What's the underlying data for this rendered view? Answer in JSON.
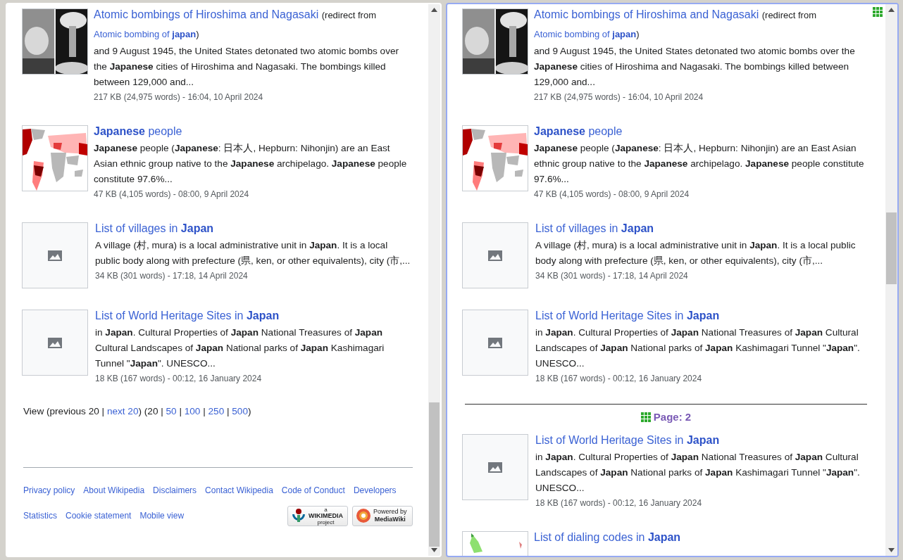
{
  "panes": [
    {
      "focused": false,
      "items": [
        {
          "kind": "result",
          "title": "Atomic bombings of Hiroshima and Nagasaki",
          "redirect_prefix": "(redirect from ",
          "redirect_title": "Atomic bombing of **japan**",
          "redirect_suffix": ")",
          "snippet": "and 9 August 1945, the United States detonated two atomic bombs over the **Japanese** cities of Hiroshima and Nagasaki. The bombings killed between 129,000 and...",
          "meta": "217 KB (24,975 words) - 16:04, 10 April 2024"
        },
        {
          "kind": "result",
          "thumb": {
            "kind": "map"
          },
          "title": "**Japanese** people",
          "snippet": "**Japanese** people (**Japanese**: 日本人, Hepburn: Nihonjin) are an East Asian ethnic group native to the **Japanese** archipelago. **Japanese** people constitute 97.6%...",
          "meta": "47 KB (4,105 words) - 08:00, 9 April 2024"
        },
        {
          "kind": "result",
          "thumb": {
            "kind": "placeholder"
          },
          "title": "List of villages in **Japan**",
          "snippet": "A village (村, mura) is a local administrative unit in **Japan**. It is a local public body along with prefecture (県, ken, or other equivalents), city (市,...",
          "meta": "34 KB (301 words) - 17:18, 14 April 2024"
        },
        {
          "kind": "result",
          "thumb": {
            "kind": "placeholder"
          },
          "title": "List of World Heritage Sites in **Japan**",
          "snippet": "in **Japan**. Cultural Properties of **Japan** National Treasures of **Japan** Cultural Landscapes of **Japan** National parks of **Japan** Kashimagari Tunnel \"**Japan**\". UNESCO...",
          "meta": "18 KB (167 words) - 00:12, 16 January 2024"
        },
        {
          "kind": "pager",
          "parts": [
            {
              "text": "View (previous 20 | ",
              "link": false
            },
            {
              "text": "next 20",
              "link": true
            },
            {
              "text": ") (20 | ",
              "link": false
            },
            {
              "text": "50",
              "link": true
            },
            {
              "text": " | ",
              "link": false
            },
            {
              "text": "100",
              "link": true
            },
            {
              "text": " | ",
              "link": false
            },
            {
              "text": "250",
              "link": true
            },
            {
              "text": " | ",
              "link": false
            },
            {
              "text": "500",
              "link": true
            },
            {
              "text": ")",
              "link": false
            }
          ]
        },
        {
          "kind": "footer",
          "rows": [
            [
              "Privacy policy",
              "About Wikipedia",
              "Disclaimers",
              "Contact Wikipedia",
              "Code of Conduct",
              "Developers"
            ],
            [
              "Statistics",
              "Cookie statement",
              "Mobile view"
            ]
          ],
          "badges": [
            {
              "kind": "wikimedia",
              "lines": [
                "a",
                "WIKIMEDIA",
                "project"
              ]
            },
            {
              "kind": "mediawiki",
              "lines": [
                "Powered by",
                "MediaWiki"
              ]
            }
          ]
        }
      ]
    },
    {
      "focused": true,
      "items": [
        {
          "kind": "result",
          "title": "Atomic bombings of Hiroshima and Nagasaki",
          "redirect_prefix": "(redirect from ",
          "redirect_title": "Atomic bombing of **japan**",
          "redirect_suffix": ")",
          "snippet": "and 9 August 1945, the United States detonated two atomic bombs over the **Japanese** cities of Hiroshima and Nagasaki. The bombings killed between 129,000 and...",
          "meta": "217 KB (24,975 words) - 16:04, 10 April 2024"
        },
        {
          "kind": "result",
          "thumb": {
            "kind": "map"
          },
          "title": "**Japanese** people",
          "snippet": "**Japanese** people (**Japanese**: 日本人, Hepburn: Nihonjin) are an East Asian ethnic group native to the **Japanese** archipelago. **Japanese** people constitute 97.6%...",
          "meta": "47 KB (4,105 words) - 08:00, 9 April 2024"
        },
        {
          "kind": "result",
          "thumb": {
            "kind": "placeholder"
          },
          "title": "List of villages in **Japan**",
          "snippet": "A village (村, mura) is a local administrative unit in **Japan**. It is a local public body along with prefecture (県, ken, or other equivalents), city (市,...",
          "meta": "34 KB (301 words) - 17:18, 14 April 2024"
        },
        {
          "kind": "result",
          "thumb": {
            "kind": "placeholder"
          },
          "title": "List of World Heritage Sites in **Japan**",
          "snippet": "in **Japan**. Cultural Properties of **Japan** National Treasures of **Japan** Cultural Landscapes of **Japan** National parks of **Japan** Kashimagari Tunnel \"**Japan**\". UNESCO...",
          "meta": "18 KB (167 words) - 00:12, 16 January 2024"
        },
        {
          "kind": "page-break",
          "label": "Page: 2"
        },
        {
          "kind": "result",
          "thumb": {
            "kind": "placeholder"
          },
          "title": "List of World Heritage Sites in **Japan**",
          "snippet": "in **Japan**. Cultural Properties of **Japan** National Treasures of **Japan** Cultural Landscapes of **Japan** National parks of **Japan** Kashimagari Tunnel \"**Japan**\". UNESCO...",
          "meta": "18 KB (167 words) - 00:12, 16 January 2024"
        },
        {
          "kind": "result",
          "thumb": {
            "kind": "map-small"
          },
          "title": "List of dialing codes in **Japan**"
        }
      ]
    }
  ]
}
